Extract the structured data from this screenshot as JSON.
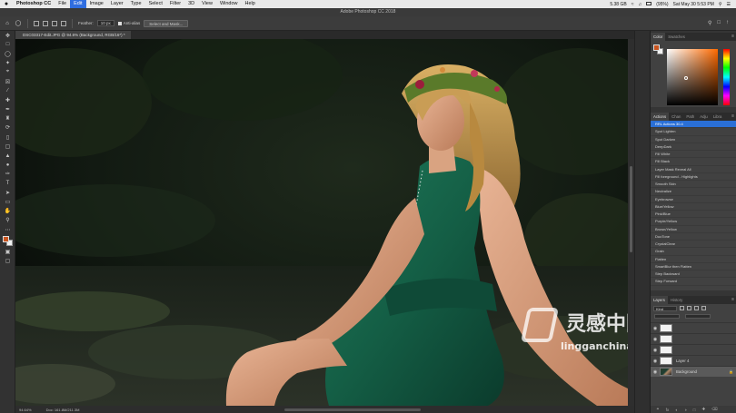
{
  "menubar": {
    "apple": "",
    "items": [
      {
        "label": "Photoshop CC",
        "bold": true
      },
      {
        "label": "File"
      },
      {
        "label": "Edit",
        "active": true
      },
      {
        "label": "Image"
      },
      {
        "label": "Layer"
      },
      {
        "label": "Type"
      },
      {
        "label": "Select"
      },
      {
        "label": "Filter"
      },
      {
        "label": "3D"
      },
      {
        "label": "View"
      },
      {
        "label": "Window"
      },
      {
        "label": "Help"
      }
    ],
    "storage": "5.38 GB",
    "battery": "(95%)",
    "datetime": "Sat May 30  5:53 PM"
  },
  "app_title": "Adobe Photoshop CC 2018",
  "options": {
    "feather_label": "Feather:",
    "feather_value": "10 px",
    "antialias_label": "Anti-alias",
    "select_mask_label": "Select and Mask..."
  },
  "document": {
    "tab_label": "DSC03317-Edit.JPG @ 94.6% (Background, RGB/16*) *",
    "zoom": "94.64%",
    "doc_info": "Doc: 161.8M/211.3M"
  },
  "color_panel": {
    "tabs": [
      "Color",
      "Swatches"
    ],
    "foreground": "#c8541f",
    "background": "#f1f1f1"
  },
  "actions_panel": {
    "tabs": [
      "Actions",
      "Chan",
      "Path",
      "Adju",
      "Libra"
    ],
    "items": [
      "RRL Actions 30.4",
      "Spot Lighten",
      "Spot Darken",
      "DeepDark",
      "Fill White",
      "Fill Black",
      "Layer Mask Reveal All",
      "Fill foreground - Highlights",
      "Smooth Skin",
      "Neutralize",
      "Eyebrowse",
      "Blue/Yellow",
      "Pink/Blue",
      "Purple/Yellow",
      "Brown/Yellow",
      "DuoTone",
      "CrystalClear",
      "Grain",
      "Flatten",
      "SmartBlur then Flatten",
      "Step Backward",
      "Step Forward"
    ]
  },
  "layers_panel": {
    "tabs": [
      "Layers",
      "History"
    ],
    "kind_label": "Kind",
    "layers": [
      {
        "name": "",
        "type": "white"
      },
      {
        "name": "",
        "type": "white"
      },
      {
        "name": "",
        "type": "white"
      },
      {
        "name": "Layer 4",
        "type": "white"
      },
      {
        "name": "Background",
        "type": "photo",
        "locked": true
      }
    ],
    "footer_icons": [
      "link-icon",
      "fx-icon",
      "mask-icon",
      "adjustment-icon",
      "folder-icon",
      "new-layer-icon",
      "trash-icon"
    ]
  },
  "watermark": {
    "cn": "灵感中国",
    "url": "lingganchina.com"
  }
}
